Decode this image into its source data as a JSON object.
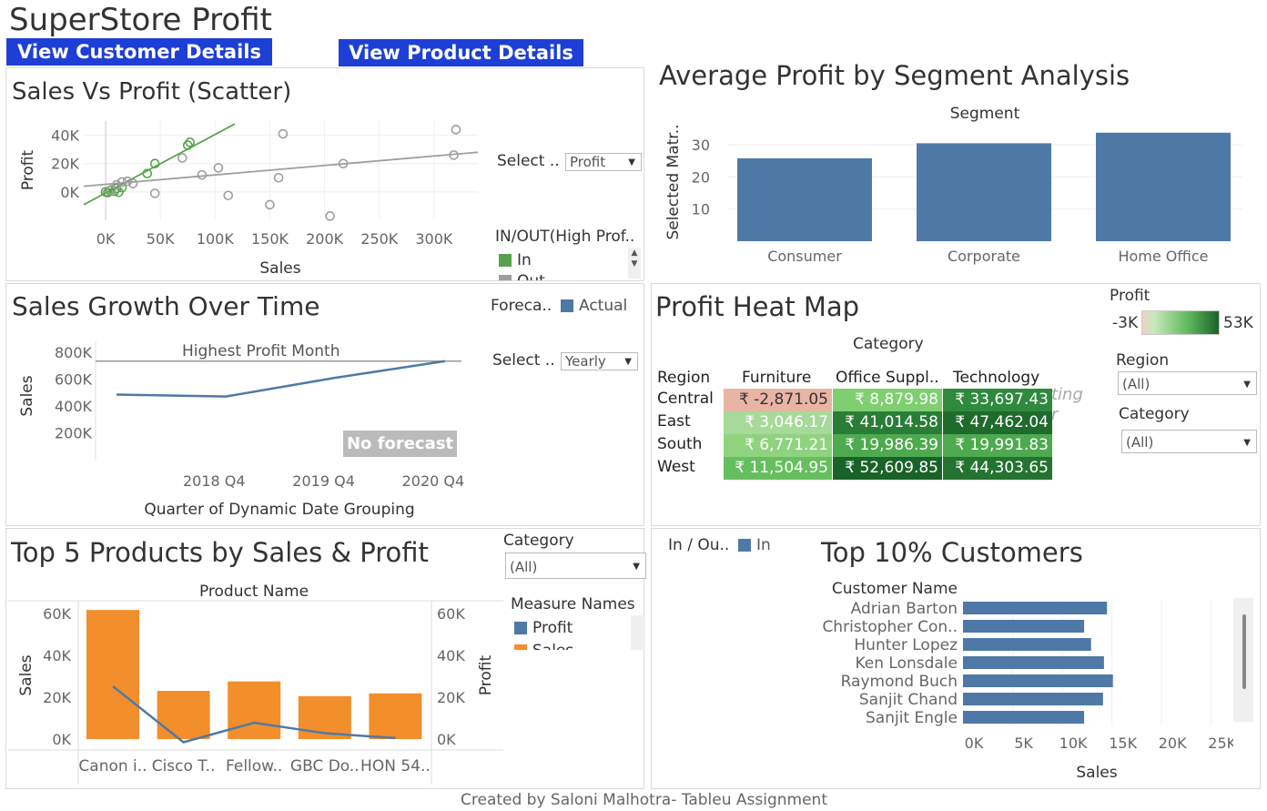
{
  "dashboard": {
    "title": "SuperStore Profit",
    "buttons": {
      "customer": "View Customer Details",
      "product": "View Product Details"
    },
    "footer": "Created by Saloni Malhotra- Tableu Assignment"
  },
  "colors": {
    "button_blue": "#1e3fd6",
    "bar_blue": "#4e79a7",
    "orange": "#f28e2b",
    "green": "#59a14f",
    "grey": "#9e9e9e"
  },
  "scatter": {
    "title": "Sales Vs Profit (Scatter)",
    "select_label": "Select ..",
    "select_value": "Profit",
    "legend_title": "IN/OUT(High Prof..",
    "legend_items": [
      "In",
      "Out"
    ],
    "chart_data": {
      "type": "scatter",
      "xlabel": "Sales",
      "ylabel": "Profit",
      "x_ticks": [
        "0K",
        "50K",
        "100K",
        "150K",
        "200K",
        "250K",
        "300K"
      ],
      "y_ticks": [
        "40K",
        "20K",
        "0K"
      ],
      "xlim": [
        -20000,
        340000
      ],
      "ylim": [
        -20000,
        50000
      ],
      "series": [
        {
          "name": "In",
          "color": "#59a14f",
          "points": [
            [
              0,
              0
            ],
            [
              2000,
              -500
            ],
            [
              4000,
              1000
            ],
            [
              8000,
              500
            ],
            [
              10000,
              2500
            ],
            [
              12000,
              -200
            ],
            [
              15000,
              3000
            ],
            [
              38000,
              13000
            ],
            [
              45000,
              20000
            ],
            [
              75000,
              33000
            ],
            [
              77000,
              35000
            ]
          ]
        },
        {
          "name": "Out",
          "color": "#9e9e9e",
          "points": [
            [
              5000,
              1500
            ],
            [
              10000,
              5000
            ],
            [
              15000,
              7000
            ],
            [
              20000,
              7500
            ],
            [
              25000,
              6000
            ],
            [
              45000,
              -1000
            ],
            [
              70000,
              24000
            ],
            [
              88000,
              12000
            ],
            [
              103000,
              17000
            ],
            [
              112000,
              -2500
            ],
            [
              150000,
              -9000
            ],
            [
              158000,
              10000
            ],
            [
              162000,
              41000
            ],
            [
              205000,
              -17000
            ],
            [
              217000,
              20000
            ],
            [
              318000,
              26000
            ],
            [
              320000,
              44000
            ]
          ]
        }
      ],
      "trend_lines": [
        {
          "series": "In",
          "from": [
            -20000,
            -9000
          ],
          "to": [
            118000,
            48000
          ]
        },
        {
          "series": "Out",
          "from": [
            -20000,
            4000
          ],
          "to": [
            340000,
            28000
          ]
        }
      ]
    }
  },
  "segment": {
    "title": "Average Profit by Segment Analysis",
    "chart_data": {
      "type": "bar",
      "title": "Segment",
      "ylabel": "Selected Matr..",
      "categories": [
        "Consumer",
        "Corporate",
        "Home Office"
      ],
      "values": [
        25.8,
        30.5,
        33.8
      ],
      "ylim": [
        0,
        36
      ],
      "y_ticks": [
        "30",
        "20",
        "10"
      ]
    }
  },
  "growth": {
    "title": "Sales Growth Over Time",
    "forecast_label": "Foreca..",
    "forecast_legend": "Actual",
    "select_label": "Select ..",
    "select_value": "Yearly",
    "reference_label": "Highest Profit Month",
    "badge": "No forecast",
    "chart_data": {
      "type": "line",
      "xlabel": "Quarter of Dynamic Date Grouping",
      "ylabel": "Sales",
      "x_ticks": [
        "2018 Q4",
        "2019 Q4",
        "2020 Q4"
      ],
      "y_ticks": [
        "800K",
        "600K",
        "400K",
        "200K"
      ],
      "ylim": [
        0,
        880000
      ],
      "points": [
        [
          2017,
          484000
        ],
        [
          2018,
          470000
        ],
        [
          2019,
          609000
        ],
        [
          2020,
          733000
        ]
      ],
      "reference_line": 733000
    }
  },
  "heatmap": {
    "title": "Profit Heat Map",
    "column_header": "Category",
    "row_header": "Region",
    "columns": [
      "Furniture",
      "Office Suppl..",
      "Technology"
    ],
    "rows": [
      {
        "region": "Central",
        "values": [
          "₹ -2,871.05",
          "₹ 8,879.98",
          "₹ 33,697.43"
        ],
        "colors": [
          "#e8b4a4",
          "#7fcf70",
          "#2f8a3e"
        ]
      },
      {
        "region": "East",
        "values": [
          "₹ 3,046.17",
          "₹ 41,014.58",
          "₹ 47,462.04"
        ],
        "colors": [
          "#a7d99a",
          "#2a7d37",
          "#1e6b2c"
        ]
      },
      {
        "region": "South",
        "values": [
          "₹ 6,771.21",
          "₹ 19,986.39",
          "₹ 19,991.83"
        ],
        "colors": [
          "#8fd37f",
          "#4eaa4f",
          "#4eaa4f"
        ]
      },
      {
        "region": "West",
        "values": [
          "₹ 11,504.95",
          "₹ 52,609.85",
          "₹ 44,303.65"
        ],
        "colors": [
          "#66bf5e",
          "#1a6328",
          "#247331"
        ]
      }
    ],
    "legend_title": "Profit",
    "legend_min": "-3K",
    "legend_max": "53K",
    "region_filter_label": "Region",
    "region_filter_value": "(All)",
    "category_filter_label": "Category",
    "category_filter_value": "(All)",
    "ghost_text": [
      "ting",
      "r"
    ]
  },
  "top5": {
    "title": "Top 5 Products by Sales & Profit",
    "category_label": "Category",
    "category_value": "(All)",
    "measure_legend_title": "Measure Names",
    "measure_items": [
      "Profit",
      "Sales"
    ],
    "chart_data": {
      "type": "bar",
      "title": "Product Name",
      "categories": [
        "Canon i..",
        "Cisco T..",
        "Fellow..",
        "GBC Do..",
        "HON 54.."
      ],
      "series": [
        {
          "name": "Sales",
          "values": [
            61600,
            23000,
            27500,
            20500,
            21800
          ],
          "axis": "left"
        },
        {
          "name": "Profit",
          "values": [
            25200,
            -1500,
            7800,
            2800,
            500
          ],
          "axis": "right"
        }
      ],
      "ylabel": "Sales",
      "y2label": "Profit",
      "ylim": [
        0,
        66000
      ],
      "y_ticks": [
        "60K",
        "40K",
        "20K",
        "0K"
      ],
      "y2_ticks": [
        "60K",
        "40K",
        "20K",
        "0K"
      ]
    }
  },
  "customers": {
    "title": "Top 10% Customers",
    "legend_title": "In / Ou..",
    "legend_item": "In",
    "chart_data": {
      "type": "bar",
      "ylabel": "Customer Name",
      "xlabel": "Sales",
      "categories": [
        "Adrian Barton",
        "Christopher Con..",
        "Hunter Lopez",
        "Ken Lonsdale",
        "Raymond Buch",
        "Sanjit Chand",
        "Sanjit Engle"
      ],
      "values": [
        14500,
        12200,
        12900,
        14200,
        15100,
        14100,
        12200
      ],
      "xlim": [
        0,
        27500
      ],
      "x_ticks": [
        "0K",
        "5K",
        "10K",
        "15K",
        "20K",
        "25K"
      ]
    }
  }
}
